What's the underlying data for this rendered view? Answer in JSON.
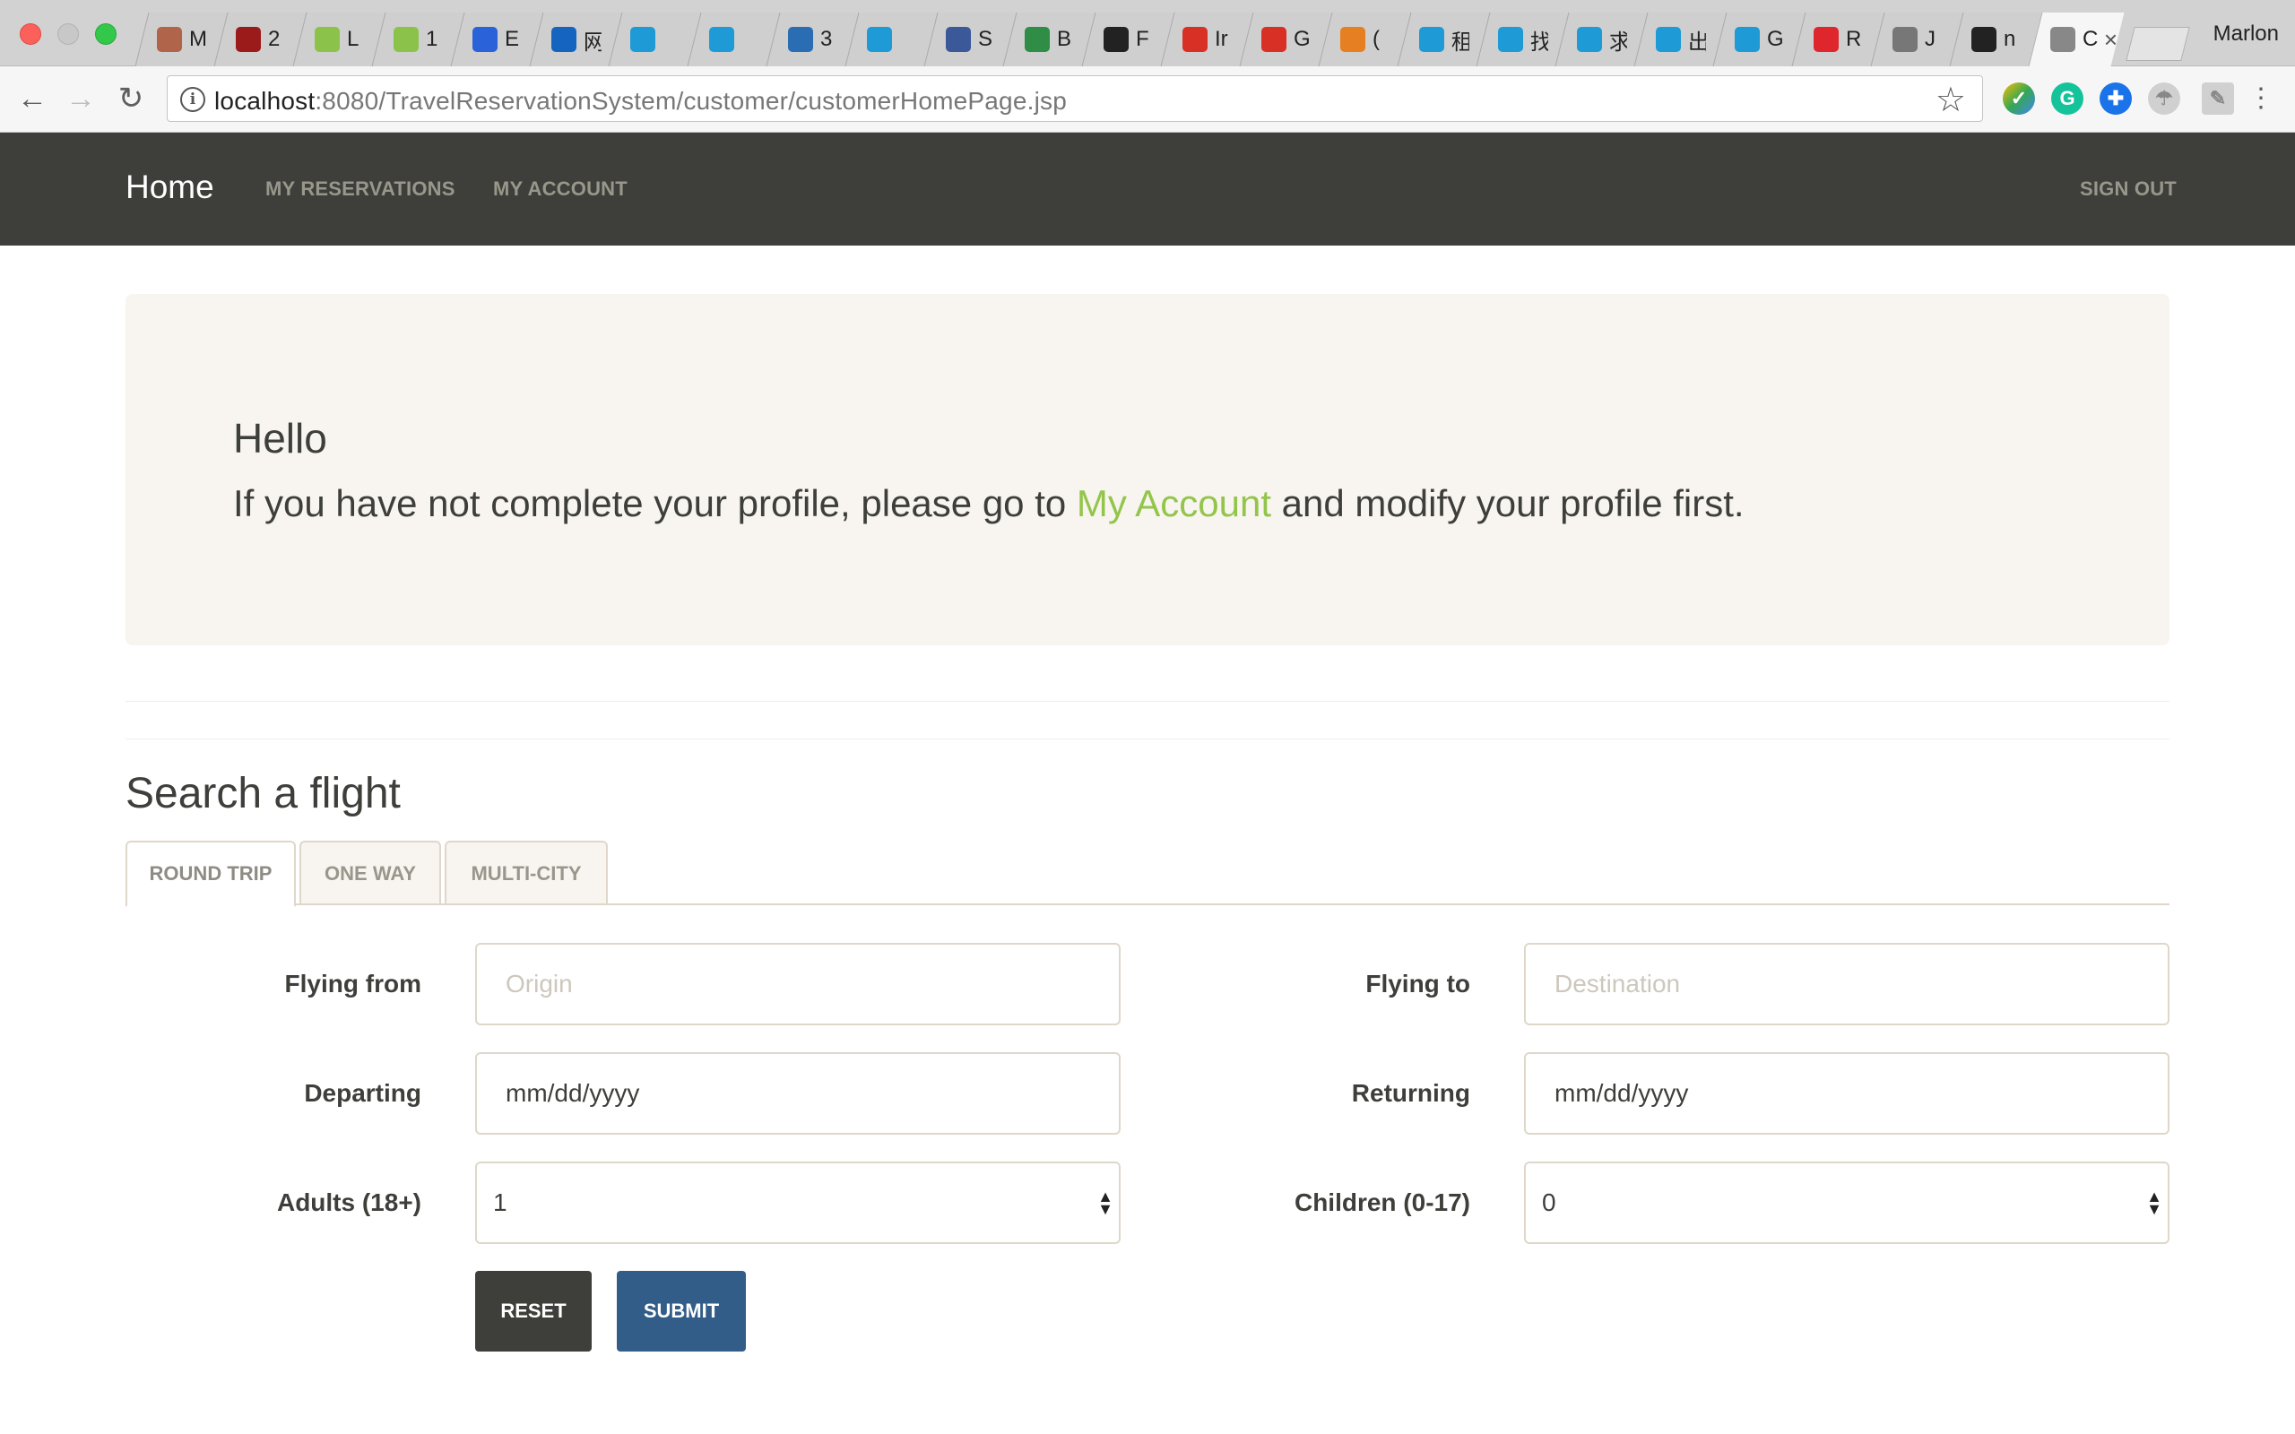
{
  "browser": {
    "profile_name": "Marlon",
    "url_host": "localhost",
    "url_rest": ":8080/TravelReservationSystem/customer/customerHomePage.jsp",
    "tabs": [
      {
        "title": "M",
        "icon": "note-icon",
        "color": "#b0644a"
      },
      {
        "title": "2",
        "icon": "c-icon",
        "color": "#9b1b1b"
      },
      {
        "title": "L",
        "icon": "leetcode-icon",
        "color": "#8bc34a"
      },
      {
        "title": "1",
        "icon": "leetcode-icon",
        "color": "#8bc34a"
      },
      {
        "title": "E",
        "icon": "baidu-icon",
        "color": "#2962d9"
      },
      {
        "title": "网",
        "icon": "telecom-icon",
        "color": "#1565c0"
      },
      {
        "title": "",
        "icon": "fish-icon",
        "color": "#1e9ad6"
      },
      {
        "title": "",
        "icon": "fish-icon",
        "color": "#1e9ad6"
      },
      {
        "title": "3",
        "icon": "infinity-icon",
        "color": "#2a6db3"
      },
      {
        "title": "",
        "icon": "fish-icon",
        "color": "#1e9ad6"
      },
      {
        "title": "S",
        "icon": "facebook-icon",
        "color": "#3b5998"
      },
      {
        "title": "B",
        "icon": "gfg-icon",
        "color": "#2f8d46"
      },
      {
        "title": "F",
        "icon": "wikipedia-icon",
        "color": "#222222"
      },
      {
        "title": "Ir",
        "icon": "gmail-icon",
        "color": "#d93025"
      },
      {
        "title": "G",
        "icon": "gmail-icon",
        "color": "#d93025"
      },
      {
        "title": "(",
        "icon": "loading-icon",
        "color": "#e67e22"
      },
      {
        "title": "租",
        "icon": "fish-icon",
        "color": "#1e9ad6"
      },
      {
        "title": "找",
        "icon": "fish-icon",
        "color": "#1e9ad6"
      },
      {
        "title": "求",
        "icon": "fish-icon",
        "color": "#1e9ad6"
      },
      {
        "title": "出",
        "icon": "fish-icon",
        "color": "#1e9ad6"
      },
      {
        "title": "G",
        "icon": "fish-icon",
        "color": "#1e9ad6"
      },
      {
        "title": "R",
        "icon": "oracle-icon",
        "color": "#e0262d"
      },
      {
        "title": "J",
        "icon": "m-icon",
        "color": "#777777"
      },
      {
        "title": "n",
        "icon": "github-icon",
        "color": "#222222"
      },
      {
        "title": "Cu",
        "icon": "page-icon",
        "color": "#888888",
        "active": true
      }
    ]
  },
  "nav": {
    "brand": "Home",
    "links": [
      "MY RESERVATIONS",
      "MY ACCOUNT"
    ],
    "signout": "SIGN OUT"
  },
  "jumbotron": {
    "heading": "Hello",
    "text_before": "If you have not complete your profile, please go to ",
    "link": "My Account",
    "text_after": " and modify your profile first."
  },
  "search": {
    "title": "Search a flight",
    "tabs": [
      "ROUND TRIP",
      "ONE WAY",
      "MULTI-CITY"
    ],
    "active_tab": "ROUND TRIP",
    "fields": {
      "from_label": "Flying from",
      "from_placeholder": "Origin",
      "to_label": "Flying to",
      "to_placeholder": "Destination",
      "depart_label": "Departing",
      "depart_value": "mm/dd/yyyy",
      "return_label": "Returning",
      "return_value": "mm/dd/yyyy",
      "adults_label": "Adults (18+)",
      "adults_value": "1",
      "children_label": "Children (0-17)",
      "children_value": "0"
    },
    "reset_label": "RESET",
    "submit_label": "SUBMIT"
  },
  "colors": {
    "navbar": "#3e3f3a",
    "accent_link": "#93c54b",
    "submit": "#325d88",
    "reset": "#3e3f3a"
  }
}
